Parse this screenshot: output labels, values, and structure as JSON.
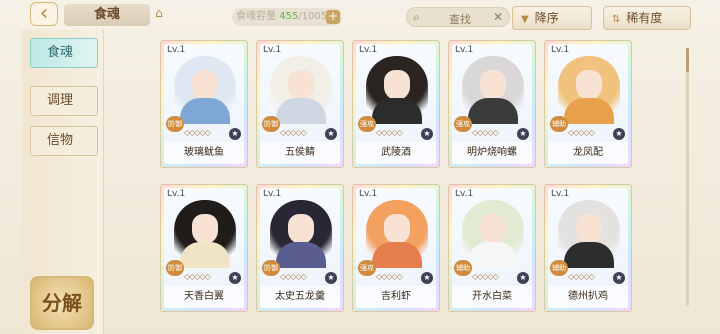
{
  "header": {
    "back_icon": "back-arrow-icon",
    "title": "食魂",
    "home_icon": "home-icon",
    "capacity_label": "食魂容量",
    "capacity_current": "455",
    "capacity_sep": "/1005",
    "search_placeholder": "查找",
    "sort_order_label": "降序",
    "sort_rarity_label": "稀有度"
  },
  "sidebar": {
    "tabs": [
      {
        "label": "食魂",
        "active": true
      },
      {
        "label": "调理",
        "active": false
      },
      {
        "label": "信物",
        "active": false
      }
    ],
    "decompose_label": "分解"
  },
  "cards": [
    {
      "level": "Lv.1",
      "name": "玻璃鱿鱼",
      "type": "防御",
      "hair": "#dfe8f2",
      "outfit": "#7fa7d6"
    },
    {
      "level": "Lv.1",
      "name": "五侯鲭",
      "type": "防御",
      "hair": "#f1efe6",
      "outfit": "#cfd7e3"
    },
    {
      "level": "Lv.1",
      "name": "武陵酒",
      "type": "强攻",
      "hair": "#2b2522",
      "outfit": "#2c2c2c"
    },
    {
      "level": "Lv.1",
      "name": "明炉烧响螺",
      "type": "强攻",
      "hair": "#d9d7d7",
      "outfit": "#3b3b3b"
    },
    {
      "level": "Lv.1",
      "name": "龙凤配",
      "type": "辅助",
      "hair": "#f1c27d",
      "outfit": "#e8a04a"
    },
    {
      "level": "Lv.1",
      "name": "天香白翼",
      "type": "防御",
      "hair": "#1f1c1a",
      "outfit": "#f0e4c6"
    },
    {
      "level": "Lv.1",
      "name": "太史五龙羹",
      "type": "防御",
      "hair": "#2a2735",
      "outfit": "#5a5d8f"
    },
    {
      "level": "Lv.1",
      "name": "吉利虾",
      "type": "强攻",
      "hair": "#f3a161",
      "outfit": "#e57d4c"
    },
    {
      "level": "Lv.1",
      "name": "开水白菜",
      "type": "辅助",
      "hair": "#e2ead3",
      "outfit": "#f6f6f6"
    },
    {
      "level": "Lv.1",
      "name": "德州扒鸡",
      "type": "辅助",
      "hair": "#e4e1e1",
      "outfit": "#2d2d2d"
    }
  ]
}
